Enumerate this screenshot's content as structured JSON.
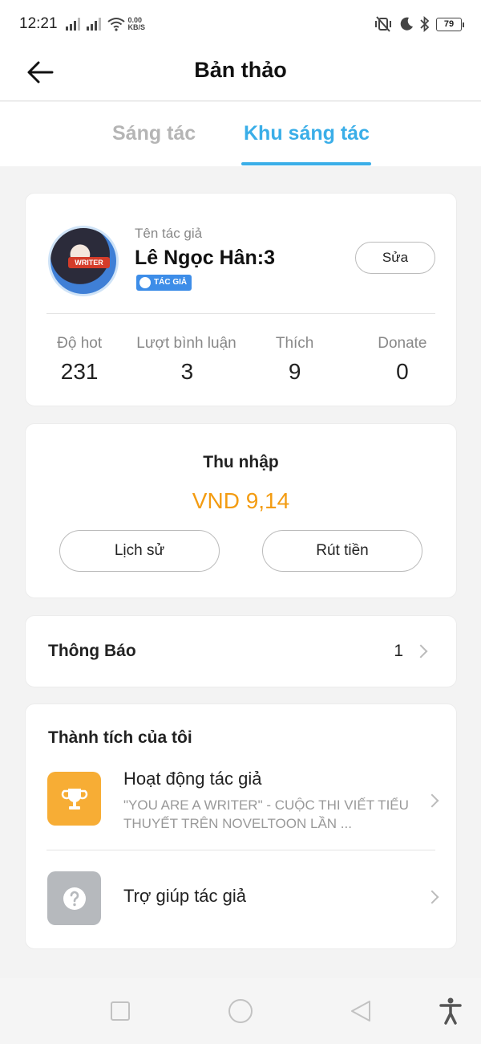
{
  "status_bar": {
    "time": "12:21",
    "net_speed_value": "0.00",
    "net_speed_unit": "KB/S",
    "battery": "79"
  },
  "header": {
    "title": "Bản thảo",
    "back_icon": "arrow-left-icon"
  },
  "tabs": [
    {
      "label": "Sáng tác",
      "active": false
    },
    {
      "label": "Khu sáng tác",
      "active": true
    }
  ],
  "profile": {
    "author_label": "Tên tác giả",
    "author_name": "Lê Ngọc Hân:3",
    "avatar_badge": "WRITER",
    "tag": "TÁC GIẢ",
    "edit_label": "Sửa",
    "stats": [
      {
        "label": "Độ hot",
        "value": "231"
      },
      {
        "label": "Lượt bình luận :",
        "value": "3"
      },
      {
        "label": "Thích",
        "value": "9"
      },
      {
        "label": "Donate",
        "value": "0"
      }
    ]
  },
  "income": {
    "title": "Thu nhập",
    "value": "VND 9,14",
    "history_label": "Lịch sử",
    "withdraw_label": "Rút tiền"
  },
  "notice": {
    "title": "Thông Báo",
    "count": "1"
  },
  "achievements": {
    "title": "Thành tích của tôi",
    "items": [
      {
        "title": "Hoạt động tác giả",
        "subtitle": "\"YOU ARE A WRITER\" - CUỘC THI VIẾT TIỂU THUYẾT TRÊN NOVELTOON LẦN ...",
        "icon": "trophy-icon"
      },
      {
        "title": "Trợ giúp tác giả",
        "subtitle": "",
        "icon": "question-icon"
      }
    ]
  },
  "colors": {
    "accent": "#3aaee8",
    "income": "#f39c12",
    "trophy_bg": "#f7ad35",
    "help_bg": "#b6b9bd"
  }
}
